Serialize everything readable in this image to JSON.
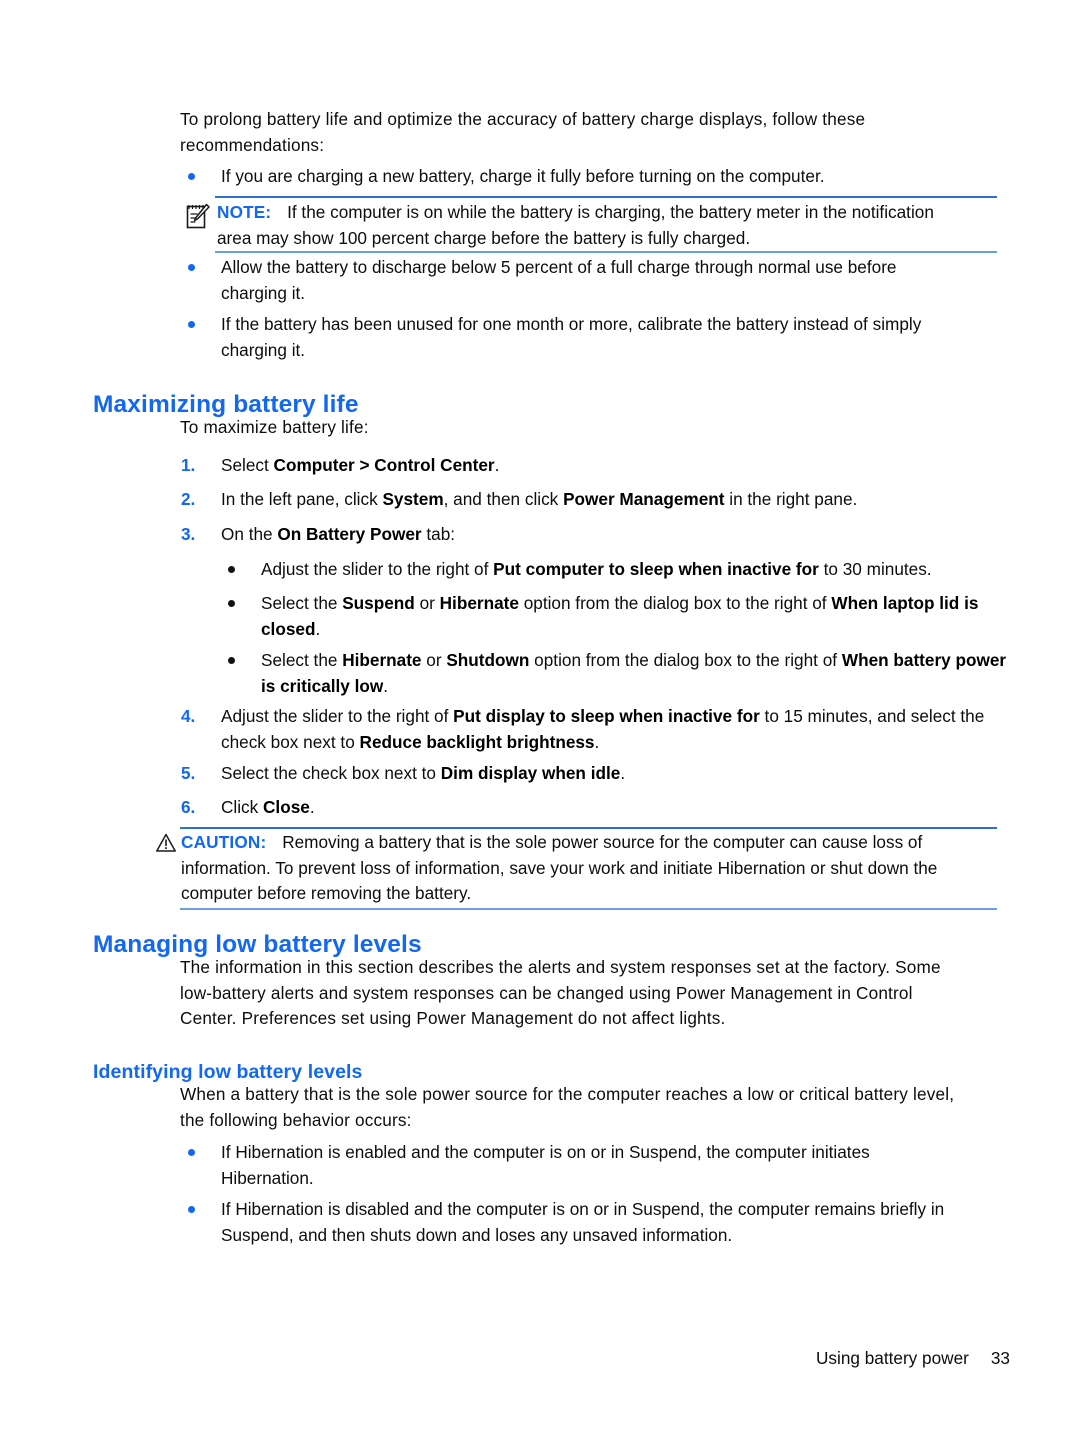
{
  "colors": {
    "heading_blue": "#1268ef",
    "rule_top_blue": "#2f6fd0",
    "rule_bottom_blue": "#6e9fe0",
    "bullet_blue": "#1268ef",
    "bullet_dark": "#111111",
    "body_text": "#0d0d0d",
    "page_background": "#ffffff"
  },
  "intro": {
    "line1": "To prolong battery life and optimize the accuracy of battery charge displays, follow these",
    "line2": "recommendations:"
  },
  "bullets_top": [
    {
      "text": "If you are charging a new battery, charge it fully before turning on the computer."
    }
  ],
  "note": {
    "icon": "note-pad-pencil-icon",
    "label": "NOTE:",
    "line1": "If the computer is on while the battery is charging, the battery meter in the notification",
    "line2": "area may show 100 percent charge before the battery is fully charged."
  },
  "bullets_after_note": [
    {
      "line1": "Allow the battery to discharge below 5 percent of a full charge through normal use before",
      "line2": "charging it."
    },
    {
      "line1": "If the battery has been unused for one month or more, calibrate the battery instead of simply",
      "line2": "charging it."
    }
  ],
  "section_maximizing": {
    "heading": "Maximizing battery life",
    "intro": "To maximize battery life:",
    "steps": [
      {
        "number": "1.",
        "parts": [
          {
            "t": "Select ",
            "bold": false
          },
          {
            "t": "Computer > Control Center",
            "bold": true
          },
          {
            "t": ".",
            "bold": false
          }
        ]
      },
      {
        "number": "2.",
        "parts": [
          {
            "t": "In the left pane, click ",
            "bold": false
          },
          {
            "t": "System",
            "bold": true
          },
          {
            "t": ", and then click ",
            "bold": false
          },
          {
            "t": "Power Management",
            "bold": true
          },
          {
            "t": " in the right pane.",
            "bold": false
          }
        ]
      },
      {
        "number": "3.",
        "parts": [
          {
            "t": "On the ",
            "bold": false
          },
          {
            "t": "On Battery Power",
            "bold": true
          },
          {
            "t": " tab:",
            "bold": false
          }
        ]
      }
    ],
    "substeps": [
      {
        "parts": [
          {
            "t": "Adjust the slider to the right of ",
            "bold": false
          },
          {
            "t": "Put computer to sleep when inactive for",
            "bold": true
          },
          {
            "t": " to 30 minutes.",
            "bold": false
          }
        ]
      },
      {
        "parts": [
          {
            "t": "Select the ",
            "bold": false
          },
          {
            "t": "Suspend",
            "bold": true
          },
          {
            "t": " or ",
            "bold": false
          },
          {
            "t": "Hibernate",
            "bold": true
          },
          {
            "t": " option from the dialog box to the right of ",
            "bold": false
          },
          {
            "t": "When laptop lid is closed",
            "bold": true
          },
          {
            "t": ".",
            "bold": false
          }
        ]
      },
      {
        "parts": [
          {
            "t": "Select the ",
            "bold": false
          },
          {
            "t": "Hibernate",
            "bold": true
          },
          {
            "t": " or ",
            "bold": false
          },
          {
            "t": "Shutdown",
            "bold": true
          },
          {
            "t": " option from the dialog box to the right of ",
            "bold": false
          },
          {
            "t": "When battery power is critically low",
            "bold": true
          },
          {
            "t": ".",
            "bold": false
          }
        ]
      }
    ],
    "steps_cont": [
      {
        "number": "4.",
        "parts": [
          {
            "t": "Adjust the slider to the right of ",
            "bold": false
          },
          {
            "t": "Put display to sleep when inactive for",
            "bold": true
          },
          {
            "t": " to 15 minutes, and select the check box next to ",
            "bold": false
          },
          {
            "t": "Reduce backlight brightness",
            "bold": true
          },
          {
            "t": ".",
            "bold": false
          }
        ]
      },
      {
        "number": "5.",
        "parts": [
          {
            "t": "Select the check box next to ",
            "bold": false
          },
          {
            "t": "Dim display when idle",
            "bold": true
          },
          {
            "t": ".",
            "bold": false
          }
        ]
      },
      {
        "number": "6.",
        "parts": [
          {
            "t": "Click ",
            "bold": false
          },
          {
            "t": "Close",
            "bold": true
          },
          {
            "t": ".",
            "bold": false
          }
        ]
      }
    ]
  },
  "caution": {
    "icon": "warning-triangle-icon",
    "label": "CAUTION:",
    "line1": "Removing a battery that is the sole power source for the computer can cause loss of",
    "line2": "information. To prevent loss of information, save your work and initiate Hibernation or shut down the",
    "line3": "computer before removing the battery."
  },
  "section_managing": {
    "heading": "Managing low battery levels",
    "body_line1": "The information in this section describes the alerts and system responses set at the factory. Some",
    "body_line2": "low-battery alerts and system responses can be changed using Power Management in Control",
    "body_line3": "Center. Preferences set using Power Management do not affect lights."
  },
  "section_identifying": {
    "heading": "Identifying low battery levels",
    "body_line1": "When a battery that is the sole power source for the computer reaches a low or critical battery level,",
    "body_line2": "the following behavior occurs:",
    "bullets": [
      {
        "line1": "If Hibernation is enabled and the computer is on or in Suspend, the computer initiates",
        "line2": "Hibernation."
      },
      {
        "line1": "If Hibernation is disabled and the computer is on or in Suspend, the computer remains briefly in",
        "line2": "Suspend, and then shuts down and loses any unsaved information."
      }
    ]
  },
  "footer": {
    "text": "Using battery power",
    "page_number": "33"
  }
}
